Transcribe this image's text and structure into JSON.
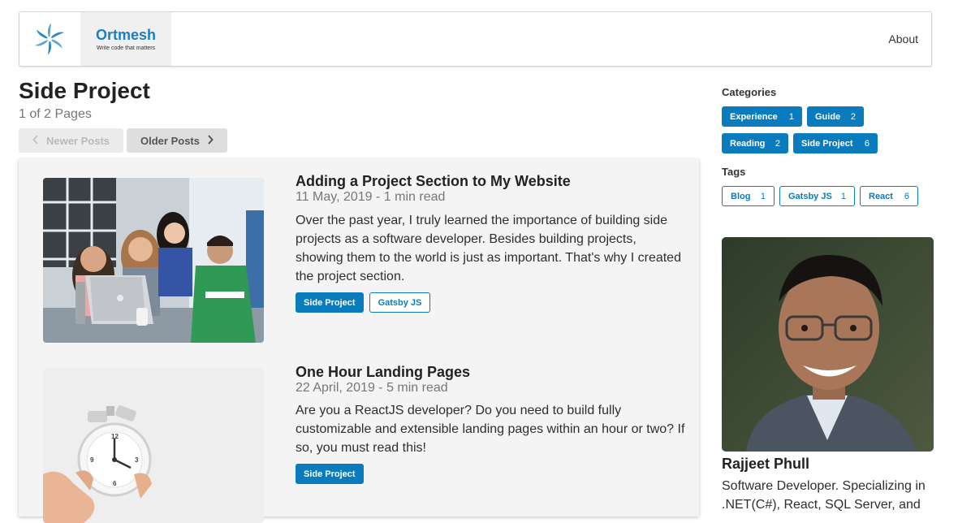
{
  "header": {
    "brand_name": "Ortmesh",
    "brand_tagline": "Write code that matters",
    "nav_about": "About"
  },
  "page": {
    "title": "Side Project",
    "page_count": "1 of 2 Pages"
  },
  "pager": {
    "newer_label": "Newer Posts",
    "older_label": "Older Posts"
  },
  "posts": [
    {
      "title": "Adding a Project Section to My Website",
      "meta": "11 May, 2019 - 1 min read",
      "excerpt": "Over the past year, I truly learned the importance of building side projects as a software developer. Besides building projects, showing them to the world is just as important. That's why I created the project section.",
      "tags": [
        "Side Project",
        "Gatsby JS"
      ]
    },
    {
      "title": "One Hour Landing Pages",
      "meta": "22 April, 2019 - 5 min read",
      "excerpt": "Are you a ReactJS developer? Do you need to build fully customizable and extensible landing pages within an hour or two? If so, you must read this!",
      "tags": [
        "Side Project"
      ]
    }
  ],
  "sidebar": {
    "categories_heading": "Categories",
    "categories": [
      {
        "label": "Experience",
        "count": "1"
      },
      {
        "label": "Guide",
        "count": "2"
      },
      {
        "label": "Reading",
        "count": "2"
      },
      {
        "label": "Side Project",
        "count": "6"
      }
    ],
    "tags_heading": "Tags",
    "tags": [
      {
        "label": "Blog",
        "count": "1"
      },
      {
        "label": "Gatsby JS",
        "count": "1"
      },
      {
        "label": "React",
        "count": "6"
      }
    ],
    "author_name": "Rajjeet Phull",
    "author_bio": "Software Developer. Specializing in .NET(C#), React, SQL Server, and"
  },
  "colors": {
    "accent": "#0a7bbd",
    "brand": "#1d7ec2"
  },
  "icons": [
    "pinwheel-logo-icon",
    "chevron-left-icon",
    "chevron-right-icon"
  ]
}
